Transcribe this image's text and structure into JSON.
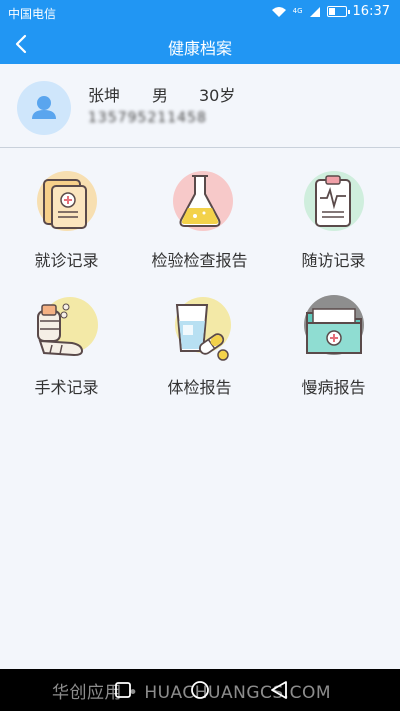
{
  "status_bar": {
    "carrier": "中国电信",
    "network_tag": "4G",
    "time": "16:37"
  },
  "header": {
    "title": "健康档案"
  },
  "profile": {
    "name": "张坤",
    "gender": "男",
    "age": "30岁",
    "phone": "135795211458"
  },
  "tiles": [
    {
      "label": "就诊记录",
      "icon": "medical-record-icon",
      "color": "#f7dfb1"
    },
    {
      "label": "检验检查报告",
      "icon": "flask-icon",
      "color": "#f7c9c9"
    },
    {
      "label": "随访记录",
      "icon": "clipboard-ecg-icon",
      "color": "#cfeedd"
    },
    {
      "label": "手术记录",
      "icon": "bandaged-arm-icon",
      "color": "#f3e9a7"
    },
    {
      "label": "体检报告",
      "icon": "water-glass-pill-icon",
      "color": "#f3e9a7"
    },
    {
      "label": "慢病报告",
      "icon": "medical-folder-icon",
      "color": "#8e8e8e"
    }
  ],
  "watermark": {
    "text": "华创应用 • HUACHUANGCS.COM"
  },
  "colors": {
    "primary": "#2196f3",
    "background": "#f3f6fb"
  }
}
